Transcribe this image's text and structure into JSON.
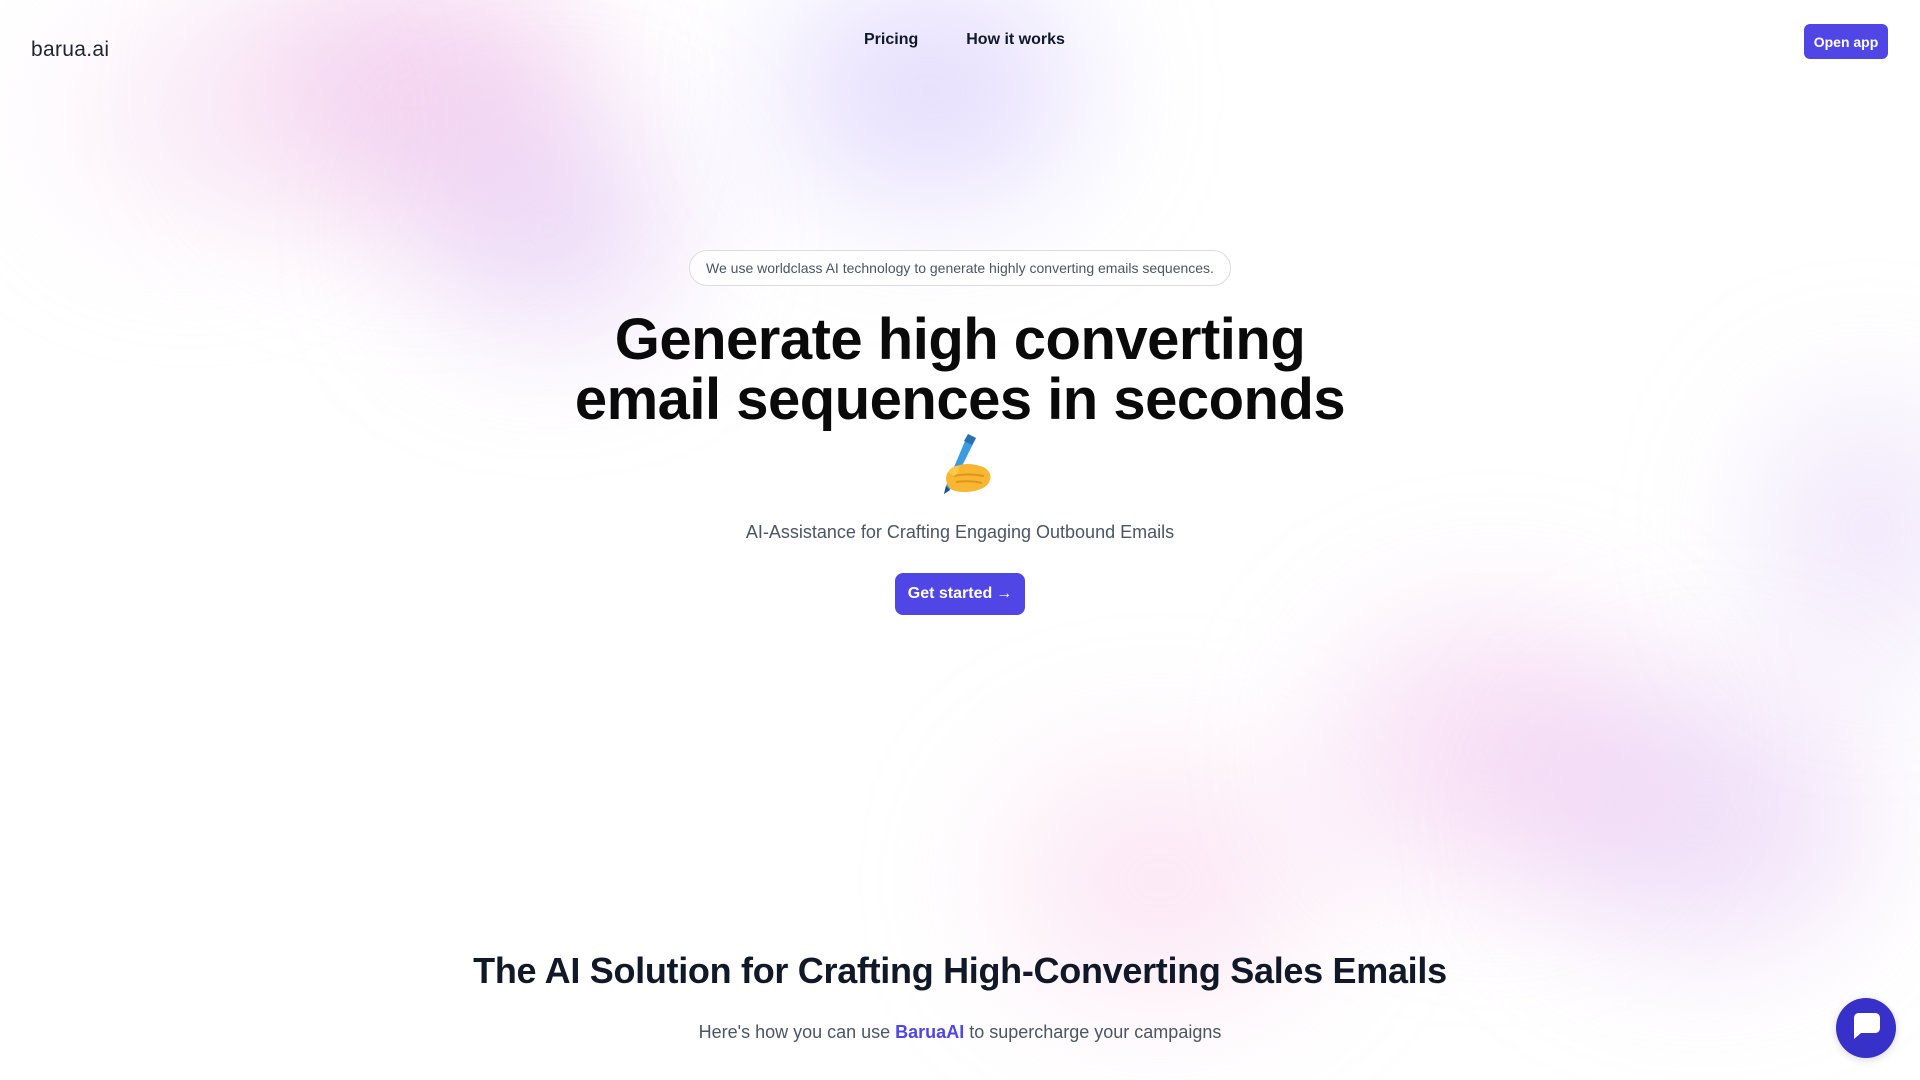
{
  "header": {
    "logo": "barua.ai",
    "nav": [
      {
        "label": "Pricing"
      },
      {
        "label": "How it works"
      }
    ],
    "open_app_label": "Open app"
  },
  "hero": {
    "pill": "We use worldclass AI technology to generate highly converting emails sequences.",
    "headline_line1": "Generate high converting",
    "headline_line2": "email sequences in seconds",
    "headline_emoji": "writing-hand-icon",
    "subtitle": "AI-Assistance for Crafting Engaging Outbound Emails",
    "cta_label": "Get started",
    "cta_arrow": "→"
  },
  "section": {
    "title": "The AI Solution for Crafting High-Converting Sales Emails",
    "sub_before": "Here's how you can use ",
    "sub_brand": "BaruaAI",
    "sub_after": " to supercharge your campaigns"
  },
  "chat": {
    "icon": "chat-bubble-icon"
  },
  "colors": {
    "accent": "#4f46e5",
    "chat": "#3730c9",
    "text_primary": "#111827",
    "text_muted": "#4b5563"
  }
}
